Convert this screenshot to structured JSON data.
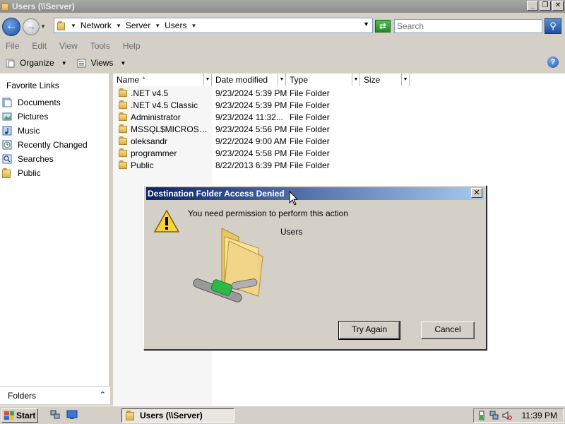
{
  "window": {
    "title": "Users (\\\\Server)",
    "controls": {
      "minimize": "_",
      "maximize": "❐",
      "close": "✕"
    }
  },
  "address_bar": {
    "crumbs": [
      "Network",
      "Server",
      "Users"
    ],
    "search_placeholder": "Search"
  },
  "menu": {
    "items": [
      "File",
      "Edit",
      "View",
      "Tools",
      "Help"
    ]
  },
  "toolbar": {
    "organize_label": "Organize",
    "views_label": "Views"
  },
  "navigation_pane": {
    "heading": "Favorite Links",
    "links": [
      {
        "label": "Documents",
        "icon": "documents-icon"
      },
      {
        "label": "Pictures",
        "icon": "pictures-icon"
      },
      {
        "label": "Music",
        "icon": "music-icon"
      },
      {
        "label": "Recently Changed",
        "icon": "recent-icon"
      },
      {
        "label": "Searches",
        "icon": "searches-icon"
      },
      {
        "label": "Public",
        "icon": "folder-icon"
      }
    ],
    "folders_label": "Folders"
  },
  "file_list": {
    "columns": [
      "Name",
      "Date modified",
      "Type",
      "Size"
    ],
    "rows": [
      {
        "name": ".NET v4.5",
        "date": "9/23/2024 5:39 PM",
        "type": "File Folder"
      },
      {
        "name": ".NET v4.5 Classic",
        "date": "9/23/2024 5:39 PM",
        "type": "File Folder"
      },
      {
        "name": "Administrator",
        "date": "9/23/2024 11:32...",
        "type": "File Folder"
      },
      {
        "name": "MSSQL$MICROSOFT...",
        "date": "9/23/2024 5:56 PM",
        "type": "File Folder"
      },
      {
        "name": "oleksandr",
        "date": "9/22/2024 9:00 AM",
        "type": "File Folder"
      },
      {
        "name": "programmer",
        "date": "9/23/2024 5:58 PM",
        "type": "File Folder"
      },
      {
        "name": "Public",
        "date": "8/22/2013 6:39 PM",
        "type": "File Folder"
      }
    ]
  },
  "dialog": {
    "title": "Destination Folder Access Denied",
    "message": "You need permission to perform this action",
    "item_name": "Users",
    "try_again_label": "Try Again",
    "cancel_label": "Cancel",
    "close_glyph": "✕"
  },
  "taskbar": {
    "start_label": "Start",
    "task_label": "Users (\\\\Server)",
    "clock": "11:39 PM"
  },
  "colors": {
    "dialog_title_start": "#0a246a",
    "dialog_title_end": "#a6caf0",
    "window_face": "#d4d0c8"
  }
}
